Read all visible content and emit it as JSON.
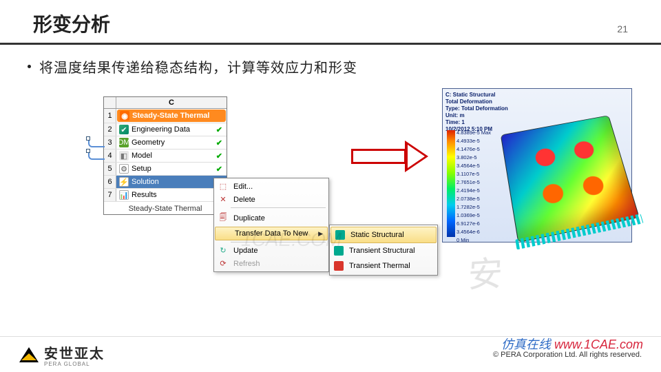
{
  "page": {
    "title": "形变分析",
    "number": "21"
  },
  "bullet": "将温度结果传递给稳态结构，计算等效应力和形变",
  "panel": {
    "column": "C",
    "rows": [
      {
        "n": "1",
        "label": "Steady-State Thermal",
        "kind": "thermal",
        "status": ""
      },
      {
        "n": "2",
        "label": "Engineering Data",
        "kind": "eng",
        "status": "tick"
      },
      {
        "n": "3",
        "label": "Geometry",
        "kind": "geom",
        "status": "tick"
      },
      {
        "n": "4",
        "label": "Model",
        "kind": "model",
        "status": "tick"
      },
      {
        "n": "5",
        "label": "Setup",
        "kind": "setup",
        "status": "tick"
      },
      {
        "n": "6",
        "label": "Solution",
        "kind": "sol",
        "status": "flash"
      },
      {
        "n": "7",
        "label": "Results",
        "kind": "res",
        "status": "flash"
      }
    ],
    "caption": "Steady-State Thermal"
  },
  "context_menu": {
    "items": [
      {
        "label": "Edit...",
        "icon": "⌘",
        "kind": "normal"
      },
      {
        "label": "Delete",
        "icon": "✕",
        "kind": "normal"
      },
      {
        "label": "Duplicate",
        "icon": "🗐",
        "kind": "normal"
      },
      {
        "label": "Transfer Data To New",
        "icon": "",
        "kind": "hl",
        "submenu": true
      },
      {
        "label": "Update",
        "icon": "↻",
        "kind": "normal"
      },
      {
        "label": "Refresh",
        "icon": "⟳",
        "kind": "dis"
      }
    ]
  },
  "submenu": {
    "items": [
      {
        "label": "Static Structural",
        "color": "teal",
        "kind": "hl"
      },
      {
        "label": "Transient Structural",
        "color": "teal",
        "kind": "normal"
      },
      {
        "label": "Transient Thermal",
        "color": "red",
        "kind": "normal"
      }
    ]
  },
  "result": {
    "title": "C: Static Structural",
    "line2": "Total Deformation",
    "line3": "Type: Total Deformation",
    "line4": "Unit: m",
    "line5": "Time: 1",
    "date": "10/2/2012 5:10 PM",
    "scale": [
      "4.8389e-5 Max",
      "4.4933e-5",
      "4.1476e-5",
      "3.802e-5",
      "3.4564e-5",
      "3.1107e-5",
      "2.7651e-5",
      "2.4194e-5",
      "2.0738e-5",
      "1.7282e-5",
      "1.0369e-5",
      "6.9127e-6",
      "3.4564e-6",
      "0 Min"
    ]
  },
  "footer": {
    "logo_main": "安世亚太",
    "logo_sub": "PERA  GLOBAL",
    "copyright": "©   PERA Corporation Ltd. All rights reserved."
  },
  "watermarks": {
    "stamp": "安",
    "center": "1CAE.COM",
    "site_prefix": "仿真在线",
    "site_domain": "www.1CAE.com"
  }
}
